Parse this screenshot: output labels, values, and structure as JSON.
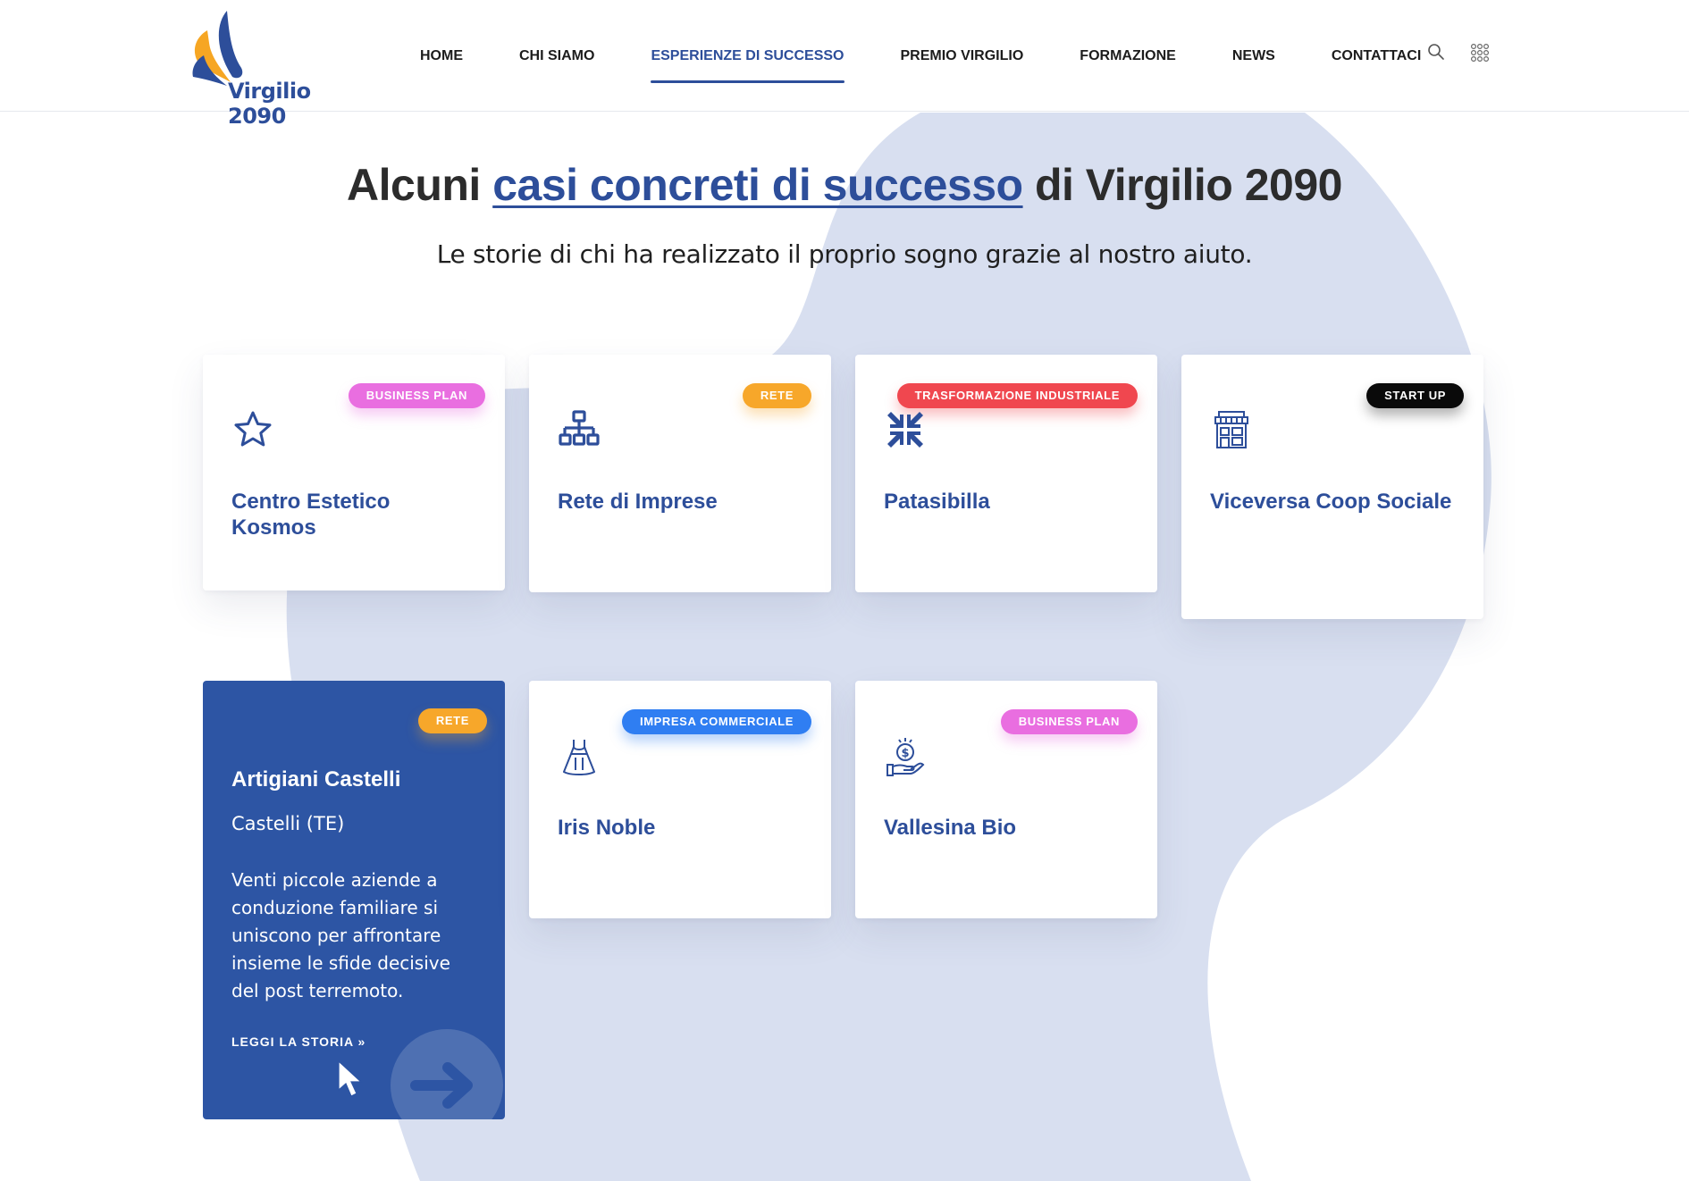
{
  "header": {
    "logo_text": "Virgilio 2090",
    "nav": [
      {
        "label": "HOME",
        "active": false
      },
      {
        "label": "CHI SIAMO",
        "active": false
      },
      {
        "label": "ESPERIENZE DI SUCCESSO",
        "active": true
      },
      {
        "label": "PREMIO VIRGILIO",
        "active": false
      },
      {
        "label": "FORMAZIONE",
        "active": false
      },
      {
        "label": "NEWS",
        "active": false
      },
      {
        "label": "CONTATTACI",
        "active": false
      }
    ],
    "icons": [
      "search-icon",
      "grid-menu-icon"
    ]
  },
  "hero": {
    "title_pre": "Alcuni ",
    "title_link": "casi concreti di successo",
    "title_post": " di Virgilio 2090",
    "subtitle": "Le storie di chi ha realizzato il proprio sogno grazie al nostro aiuto."
  },
  "cards": [
    {
      "title": "Centro Estetico Kosmos",
      "badge": "BUSINESS PLAN",
      "badge_color": "#e96ee0",
      "icon": "star-icon"
    },
    {
      "title": "Rete di Imprese",
      "badge": "RETE",
      "badge_color": "#f7a72a",
      "icon": "network-icon"
    },
    {
      "title": "Patasibilla",
      "badge": "TRASFORMAZIONE INDUSTRIALE",
      "badge_color": "#f0474f",
      "icon": "compress-arrows-icon"
    },
    {
      "title": "Viceversa Coop Sociale",
      "badge": "START UP",
      "badge_color": "#0a0a0a",
      "icon": "shop-building-icon"
    },
    {
      "title": "Artigiani Castelli",
      "badge": "RETE",
      "badge_color": "#f7a72a",
      "location": "Castelli (TE)",
      "description": "Venti piccole aziende a conduzione familiare si uniscono per affrontare insieme le sfide decisive del post terremoto.",
      "cta": "LEGGI LA STORIA",
      "featured": true
    },
    {
      "title": "Iris Noble",
      "badge": "IMPRESA COMMERCIALE",
      "badge_color": "#2f7ef2",
      "icon": "dress-icon"
    },
    {
      "title": "Vallesina Bio",
      "badge": "BUSINESS PLAN",
      "badge_color": "#e96ee0",
      "icon": "money-hand-icon"
    }
  ],
  "colors": {
    "brand_blue": "#2d4e9a",
    "featured_bg": "#2d55a4",
    "blob": "#d8dff0"
  }
}
